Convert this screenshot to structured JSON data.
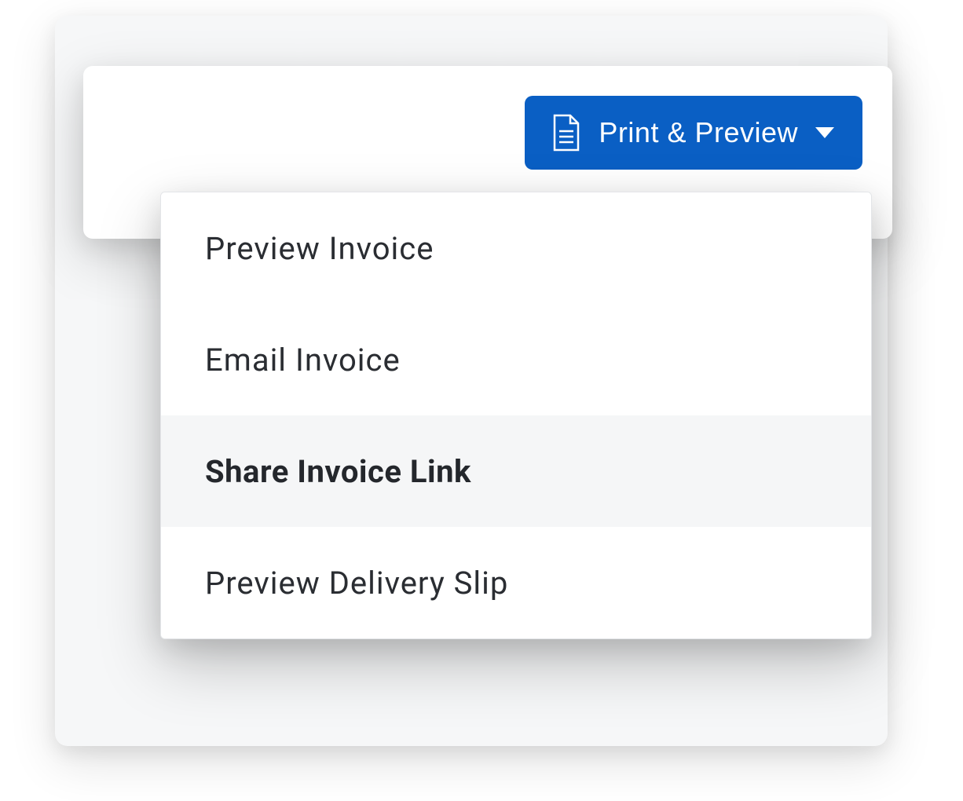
{
  "button": {
    "label": "Print & Preview"
  },
  "menu": {
    "items": [
      {
        "label": "Preview Invoice",
        "active": false
      },
      {
        "label": "Email Invoice",
        "active": false
      },
      {
        "label": "Share Invoice Link",
        "active": true
      },
      {
        "label": "Preview Delivery Slip",
        "active": false
      }
    ]
  },
  "colors": {
    "primary": "#0a5fc4",
    "panel_bg": "#f6f7f8",
    "text": "#2a2d32"
  }
}
